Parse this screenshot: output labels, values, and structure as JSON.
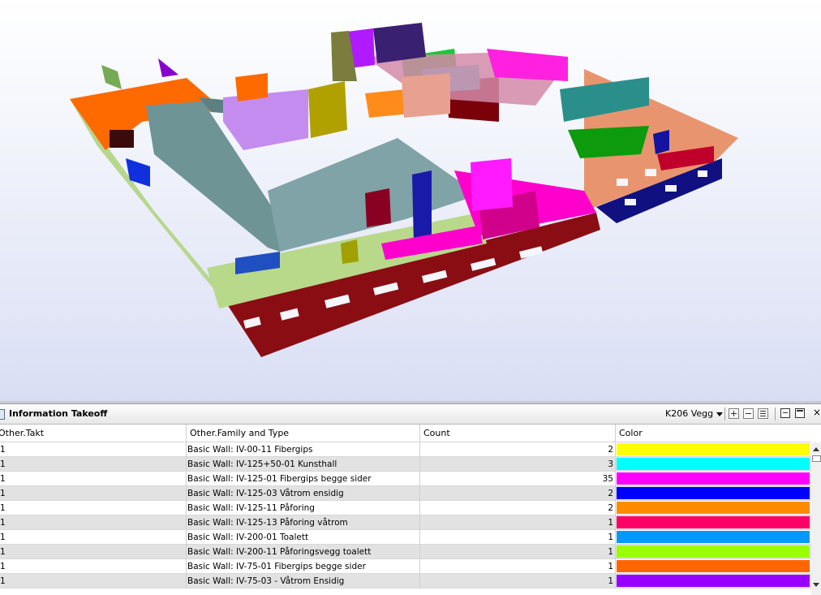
{
  "panel": {
    "title": "Information Takeoff",
    "profile_selected": "K206 Vegg"
  },
  "table": {
    "columns": [
      "Other.Takt",
      "Other.Family and Type",
      "Count",
      "Color"
    ],
    "rows": [
      {
        "takt": "1",
        "family": "Basic Wall: IV-00-11 Fibergips",
        "count": "2",
        "color": "#ffff00"
      },
      {
        "takt": "1",
        "family": "Basic Wall: IV-125+50-01 Kunsthall",
        "count": "3",
        "color": "#00ffff"
      },
      {
        "takt": "1",
        "family": "Basic Wall: IV-125-01 Fibergips begge sider",
        "count": "35",
        "color": "#ff00ff"
      },
      {
        "takt": "1",
        "family": "Basic Wall: IV-125-03 Våtrom ensidig",
        "count": "2",
        "color": "#0000ff"
      },
      {
        "takt": "1",
        "family": "Basic Wall: IV-125-11 Påforing",
        "count": "2",
        "color": "#ff8c00"
      },
      {
        "takt": "1",
        "family": "Basic Wall: IV-125-13 Påforing våtrom",
        "count": "1",
        "color": "#ff0066"
      },
      {
        "takt": "1",
        "family": "Basic Wall: IV-200-01 Toalett",
        "count": "1",
        "color": "#0099ff"
      },
      {
        "takt": "1",
        "family": "Basic Wall: IV-200-11 Påforingsvegg toalett",
        "count": "1",
        "color": "#99ff00"
      },
      {
        "takt": "1",
        "family": "Basic Wall: IV-75-01 Fibergips begge sider",
        "count": "1",
        "color": "#ff6600"
      },
      {
        "takt": "1",
        "family": "Basic Wall: IV-75-03 - Våtrom Ensidig",
        "count": "1",
        "color": "#9900ff"
      }
    ]
  },
  "icons": {
    "panel": "panel-icon",
    "dropdown": "chevron-down-icon",
    "add": "plus-icon",
    "remove": "minus-icon",
    "list": "list-icon",
    "restore": "restore-window-icon",
    "maximize": "maximize-icon",
    "close": "close-icon"
  }
}
